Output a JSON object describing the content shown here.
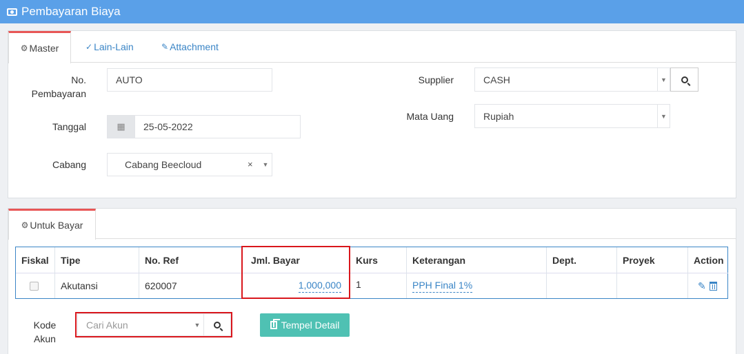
{
  "header": {
    "title": "Pembayaran Biaya",
    "icon": "money-icon"
  },
  "tabs": [
    {
      "label": "Master",
      "icon": "cogs-icon"
    },
    {
      "label": "Lain-Lain",
      "icon": "check-circle-icon"
    },
    {
      "label": "Attachment",
      "icon": "paperclip-icon"
    }
  ],
  "form": {
    "no_pembayaran_label_1": "No.",
    "no_pembayaran_label_2": "Pembayaran",
    "no_pembayaran_value": "AUTO",
    "tanggal_label": "Tanggal",
    "tanggal_value": "25-05-2022",
    "cabang_label": "Cabang",
    "cabang_value": "Cabang Beecloud",
    "supplier_label": "Supplier",
    "supplier_value": "CASH",
    "mata_uang_label": "Mata Uang",
    "mata_uang_value": "Rupiah"
  },
  "detail_tab": {
    "label": "Untuk Bayar",
    "icon": "cogs-icon"
  },
  "table": {
    "headers": [
      "Fiskal",
      "Tipe",
      "No. Ref",
      "Jml. Bayar",
      "Kurs",
      "Keterangan",
      "Dept.",
      "Proyek",
      "Action"
    ],
    "rows": [
      {
        "fiskal": "",
        "tipe": "Akutansi",
        "no_ref": "620007",
        "jml_bayar": "1,000,000",
        "kurs": "1",
        "keterangan": "PPH Final 1%",
        "dept": "",
        "proyek": ""
      }
    ]
  },
  "kode_akun": {
    "label_1": "Kode",
    "label_2": "Akun",
    "placeholder": "Cari Akun"
  },
  "tempel_button": {
    "label": "Tempel Detail"
  },
  "highlight_color": "#d9161c",
  "accent_color": "#5aa0e8"
}
